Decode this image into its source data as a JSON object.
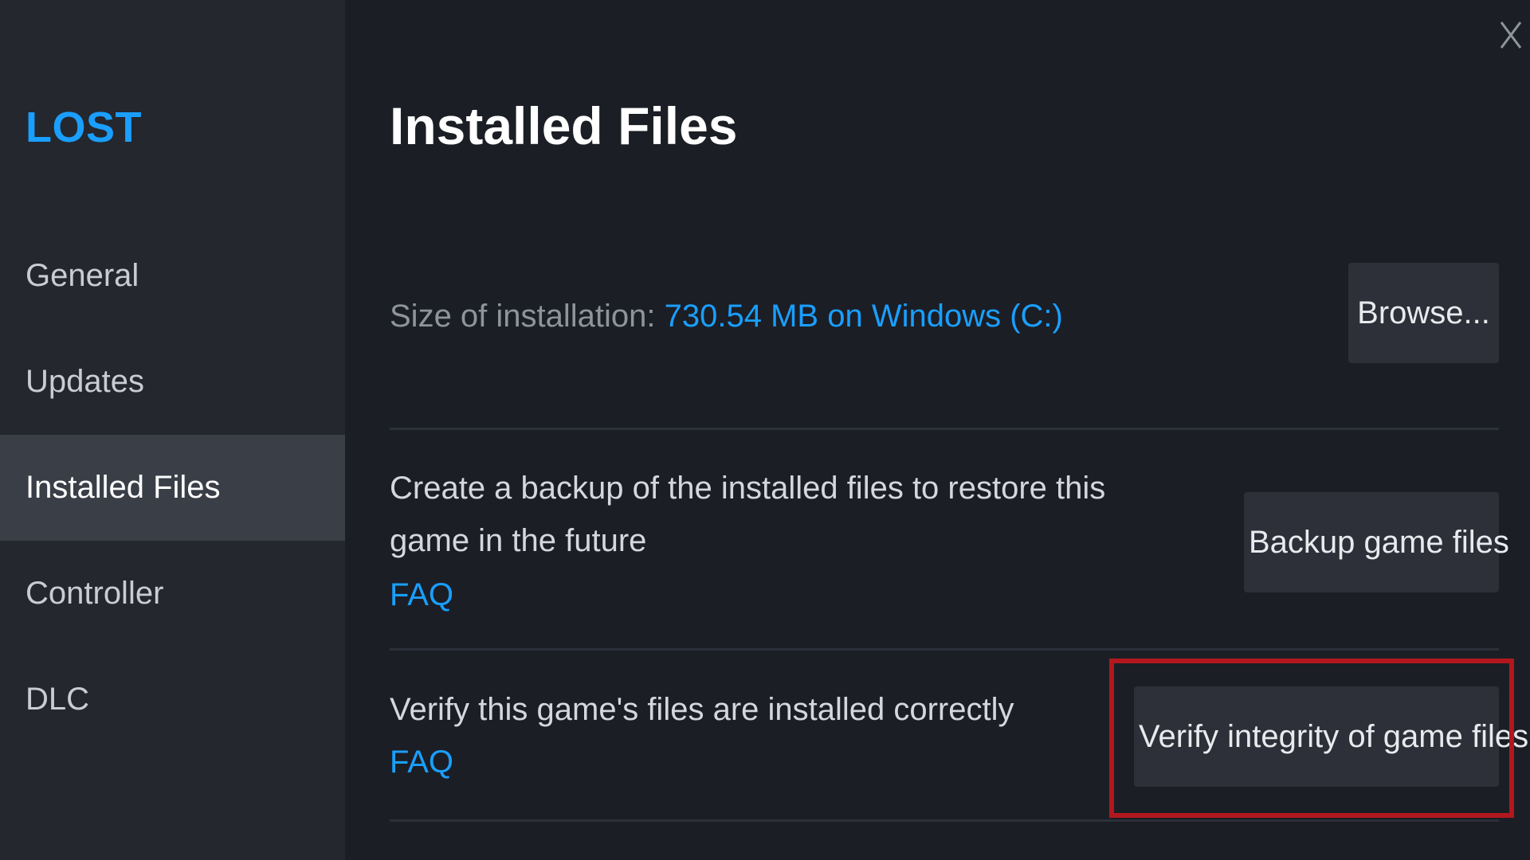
{
  "sidebar": {
    "game_title": "LOST",
    "items": [
      {
        "label": "General",
        "active": false
      },
      {
        "label": "Updates",
        "active": false
      },
      {
        "label": "Installed Files",
        "active": true
      },
      {
        "label": "Controller",
        "active": false
      },
      {
        "label": "DLC",
        "active": false
      }
    ]
  },
  "main": {
    "title": "Installed Files",
    "install_size": {
      "label": "Size of installation: ",
      "value": "730.54 MB on Windows (C:)",
      "button": "Browse..."
    },
    "backup": {
      "description": "Create a backup of the installed files to restore this game in the future",
      "faq": "FAQ",
      "button": "Backup game files"
    },
    "verify": {
      "description": "Verify this game's files are installed correctly",
      "faq": "FAQ",
      "button": "Verify integrity of game files"
    }
  },
  "colors": {
    "accent": "#1a9fff",
    "sidebar_bg": "#24272e",
    "main_bg": "#1b1e25",
    "highlight": "#b3171e"
  },
  "icons": {
    "close": "close-icon"
  }
}
